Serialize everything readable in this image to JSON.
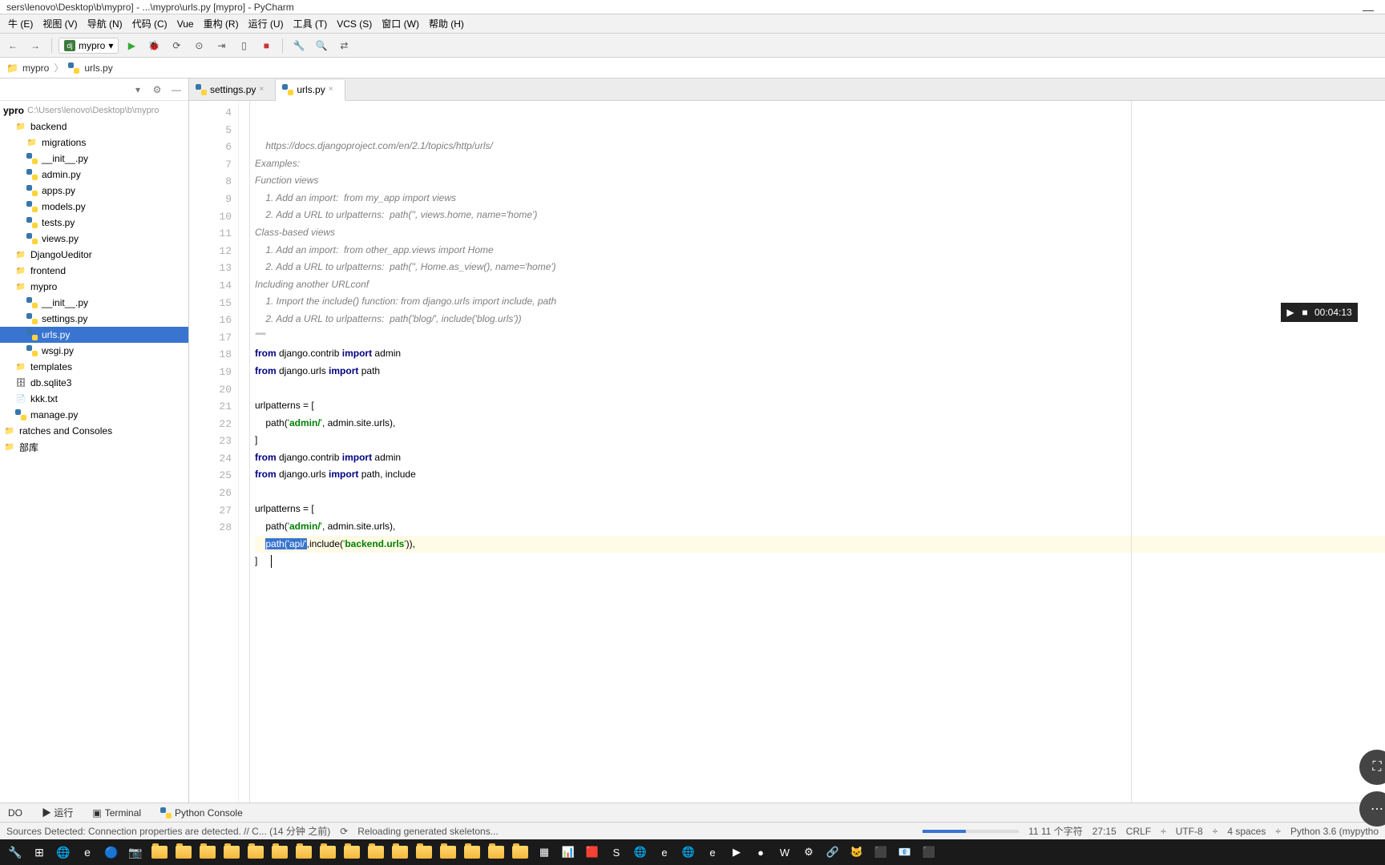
{
  "title": "sers\\lenovo\\Desktop\\b\\mypro] - ...\\mypro\\urls.py [mypro] - PyCharm",
  "menu": [
    "牛 (E)",
    "视图 (V)",
    "导航 (N)",
    "代码 (C)",
    "Vue",
    "重构 (R)",
    "运行 (U)",
    "工具 (T)",
    "VCS (S)",
    "窗口 (W)",
    "帮助 (H)"
  ],
  "run_config": "mypro",
  "breadcrumb": {
    "items": [
      "mypro",
      "urls.py"
    ]
  },
  "project": {
    "root": {
      "name": "ypro",
      "hint": "C:\\Users\\lenovo\\Desktop\\b\\mypro"
    },
    "nodes": [
      {
        "indent": 0,
        "icon": "folder",
        "label": "backend"
      },
      {
        "indent": 1,
        "icon": "folder",
        "label": "migrations"
      },
      {
        "indent": 1,
        "icon": "py",
        "label": "__init__.py"
      },
      {
        "indent": 1,
        "icon": "py",
        "label": "admin.py"
      },
      {
        "indent": 1,
        "icon": "py",
        "label": "apps.py"
      },
      {
        "indent": 1,
        "icon": "py",
        "label": "models.py"
      },
      {
        "indent": 1,
        "icon": "py",
        "label": "tests.py"
      },
      {
        "indent": 1,
        "icon": "py",
        "label": "views.py"
      },
      {
        "indent": 0,
        "icon": "folder",
        "label": "DjangoUeditor"
      },
      {
        "indent": 0,
        "icon": "folder",
        "label": "frontend"
      },
      {
        "indent": 0,
        "icon": "folder",
        "label": "mypro"
      },
      {
        "indent": 1,
        "icon": "py",
        "label": "__init__.py"
      },
      {
        "indent": 1,
        "icon": "py",
        "label": "settings.py"
      },
      {
        "indent": 1,
        "icon": "py",
        "label": "urls.py",
        "selected": true
      },
      {
        "indent": 1,
        "icon": "py",
        "label": "wsgi.py"
      },
      {
        "indent": 0,
        "icon": "folder",
        "label": "templates"
      },
      {
        "indent": 0,
        "icon": "db",
        "label": "db.sqlite3"
      },
      {
        "indent": 0,
        "icon": "txt",
        "label": "kkk.txt"
      },
      {
        "indent": 0,
        "icon": "py",
        "label": "manage.py"
      },
      {
        "indent": -1,
        "icon": "folder",
        "label": "ratches and Consoles"
      },
      {
        "indent": -1,
        "icon": "folder",
        "label": "部库"
      }
    ]
  },
  "tabs": [
    {
      "label": "settings.py",
      "active": false
    },
    {
      "label": "urls.py",
      "active": true
    }
  ],
  "gutter_start": 4,
  "gutter_end": 28,
  "code": [
    {
      "html": "    <span class='c-comment'>https://docs.djangoproject.com/en/2.1/topics/http/urls/</span>"
    },
    {
      "html": "<span class='c-comment'>Examples:</span>"
    },
    {
      "html": "<span class='c-comment'>Function views</span>"
    },
    {
      "html": "    <span class='c-comment'>1. Add an import:  from my_app import views</span>"
    },
    {
      "html": "    <span class='c-comment'>2. Add a URL to urlpatterns:  path('', views.home, name='home')</span>"
    },
    {
      "html": "<span class='c-comment'>Class-based views</span>"
    },
    {
      "html": "    <span class='c-comment'>1. Add an import:  from other_app.views import Home</span>"
    },
    {
      "html": "    <span class='c-comment'>2. Add a URL to urlpatterns:  path('', Home.as_view(), name='home')</span>"
    },
    {
      "html": "<span class='c-comment'>Including another URLconf</span>"
    },
    {
      "html": "    <span class='c-comment'>1. Import the include() function: from django.urls import include, path</span>"
    },
    {
      "html": "    <span class='c-comment'>2. Add a URL to urlpatterns:  path('blog/', include('blog.urls'))</span>"
    },
    {
      "html": "<span class='c-comment'>\"\"\"</span>"
    },
    {
      "html": "<span class='c-keyword'>from</span> django.contrib <span class='c-keyword'>import</span> admin"
    },
    {
      "html": "<span class='c-keyword'>from</span> django.urls <span class='c-keyword'>import</span> path"
    },
    {
      "html": ""
    },
    {
      "html": "urlpatterns = ["
    },
    {
      "html": "    path(<span class='c-string'>'</span><span class='c-string2'>admin/</span><span class='c-string'>'</span>, admin.site.urls),"
    },
    {
      "html": "]"
    },
    {
      "html": "<span class='c-keyword'>from</span> django.contrib <span class='c-keyword'>import</span> admin"
    },
    {
      "html": "<span class='c-keyword'>from</span> django.urls <span class='c-keyword'>import</span> path, include"
    },
    {
      "html": ""
    },
    {
      "html": "urlpatterns = ["
    },
    {
      "html": "    path(<span class='c-string'>'</span><span class='c-string2'>admin/</span><span class='c-string'>'</span>, admin.site.urls),"
    },
    {
      "html": "    <span class='c-sel'>path(</span><span class='c-sel'>'</span><span class='c-sel'>api/</span><span class='c-sel'>'</span>,include(<span class='c-string'>'</span><span class='c-string2'>backend.urls</span><span class='c-string'>'</span>)),",
      "hl": true
    },
    {
      "html": "]     <span class='caret'></span>"
    }
  ],
  "bottom_tabs": [
    "DO",
    "▶ 运行",
    "Terminal",
    "Python Console"
  ],
  "status": {
    "left": "Sources Detected: Connection properties are detected. // C... (14 分钟 之前)",
    "reload": "Reloading generated skeletons...",
    "pos": "11 11 个字符",
    "colline": "27:15",
    "sep": "CRLF",
    "enc": "UTF-8",
    "indent": "4 spaces",
    "interp": "Python 3.6 (mypytho"
  },
  "video_time": "00:04:13"
}
